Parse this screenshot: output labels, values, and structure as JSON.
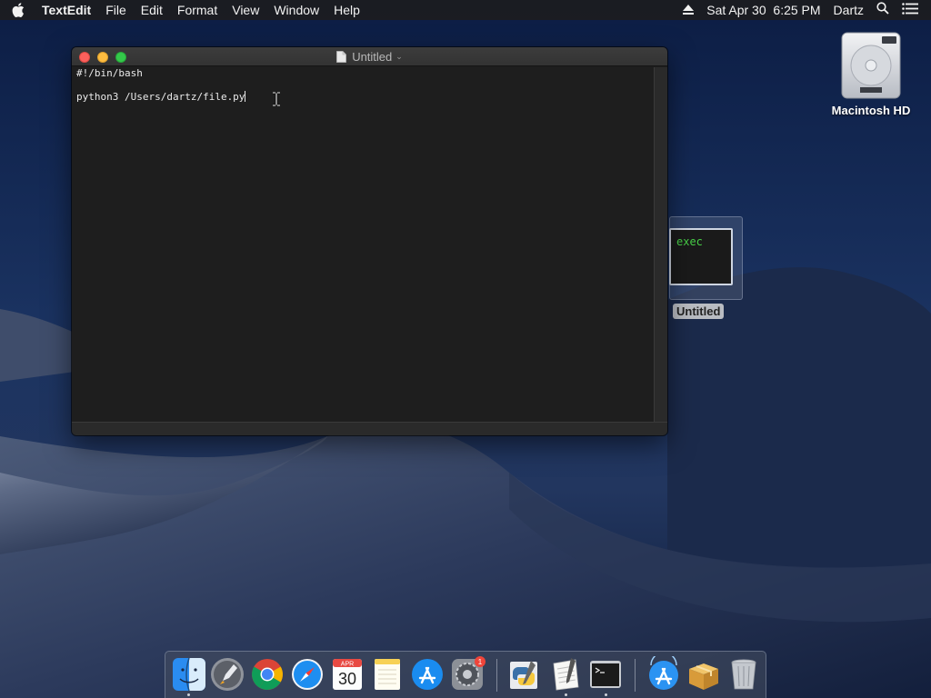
{
  "menubar": {
    "app_name": "TextEdit",
    "menus": [
      "File",
      "Edit",
      "Format",
      "View",
      "Window",
      "Help"
    ],
    "datetime": "Sat Apr 30  6:25 PM",
    "user": "Dartz"
  },
  "desktop": {
    "hd_label": "Macintosh HD",
    "preview_label": "Untitled",
    "preview_text": "exec"
  },
  "window": {
    "title": "Untitled",
    "lines": [
      "#!/bin/bash",
      "",
      "python3 /Users/dartz/file.py"
    ]
  },
  "dock": {
    "apps": [
      "Finder",
      "Launchpad",
      "Google Chrome",
      "Safari",
      "Calendar",
      "Notes",
      "App Store",
      "System Preferences",
      "Python Launcher",
      "TextEdit",
      "Terminal",
      "Applications",
      "Archive",
      "Trash"
    ],
    "calendar": {
      "month": "APR",
      "day": "30"
    },
    "sysprefs_badge": "1"
  },
  "colors": {
    "close": "#fc605c",
    "minimize": "#fdbc40",
    "maximize": "#34c84a",
    "terminal_green": "#48d048"
  }
}
